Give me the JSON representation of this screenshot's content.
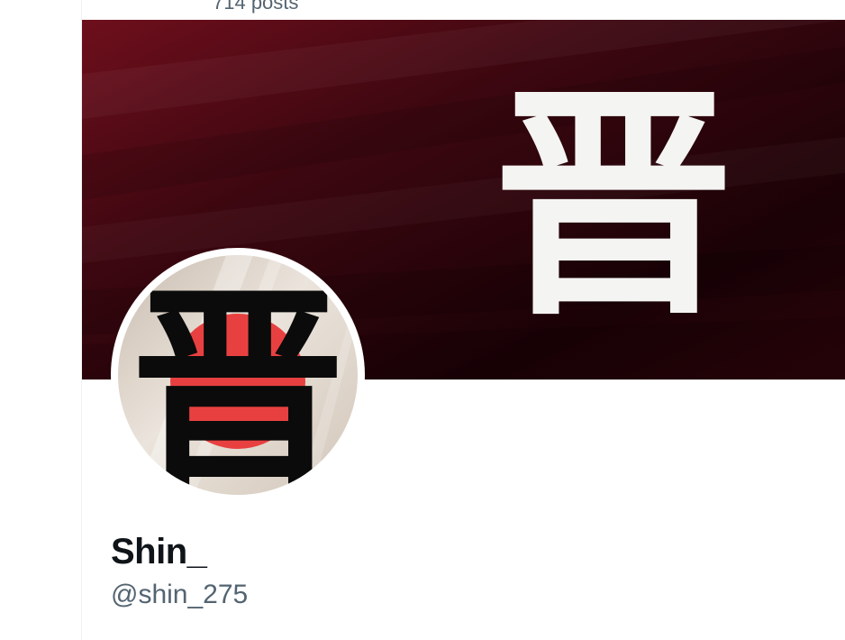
{
  "header": {
    "post_count": "714 posts"
  },
  "profile": {
    "display_name": "Shin_",
    "handle": "@shin_275"
  },
  "banner": {
    "glyph": "晋",
    "colors": {
      "dark": "#1a0206",
      "mid": "#3d0710",
      "bright": "#6e0f1c",
      "glyph": "#f4f4f2"
    }
  },
  "avatar": {
    "glyph": "晋",
    "colors": {
      "background": "#e3dbd2",
      "sun": "#e84040",
      "glyph": "#0b0b0b"
    }
  }
}
